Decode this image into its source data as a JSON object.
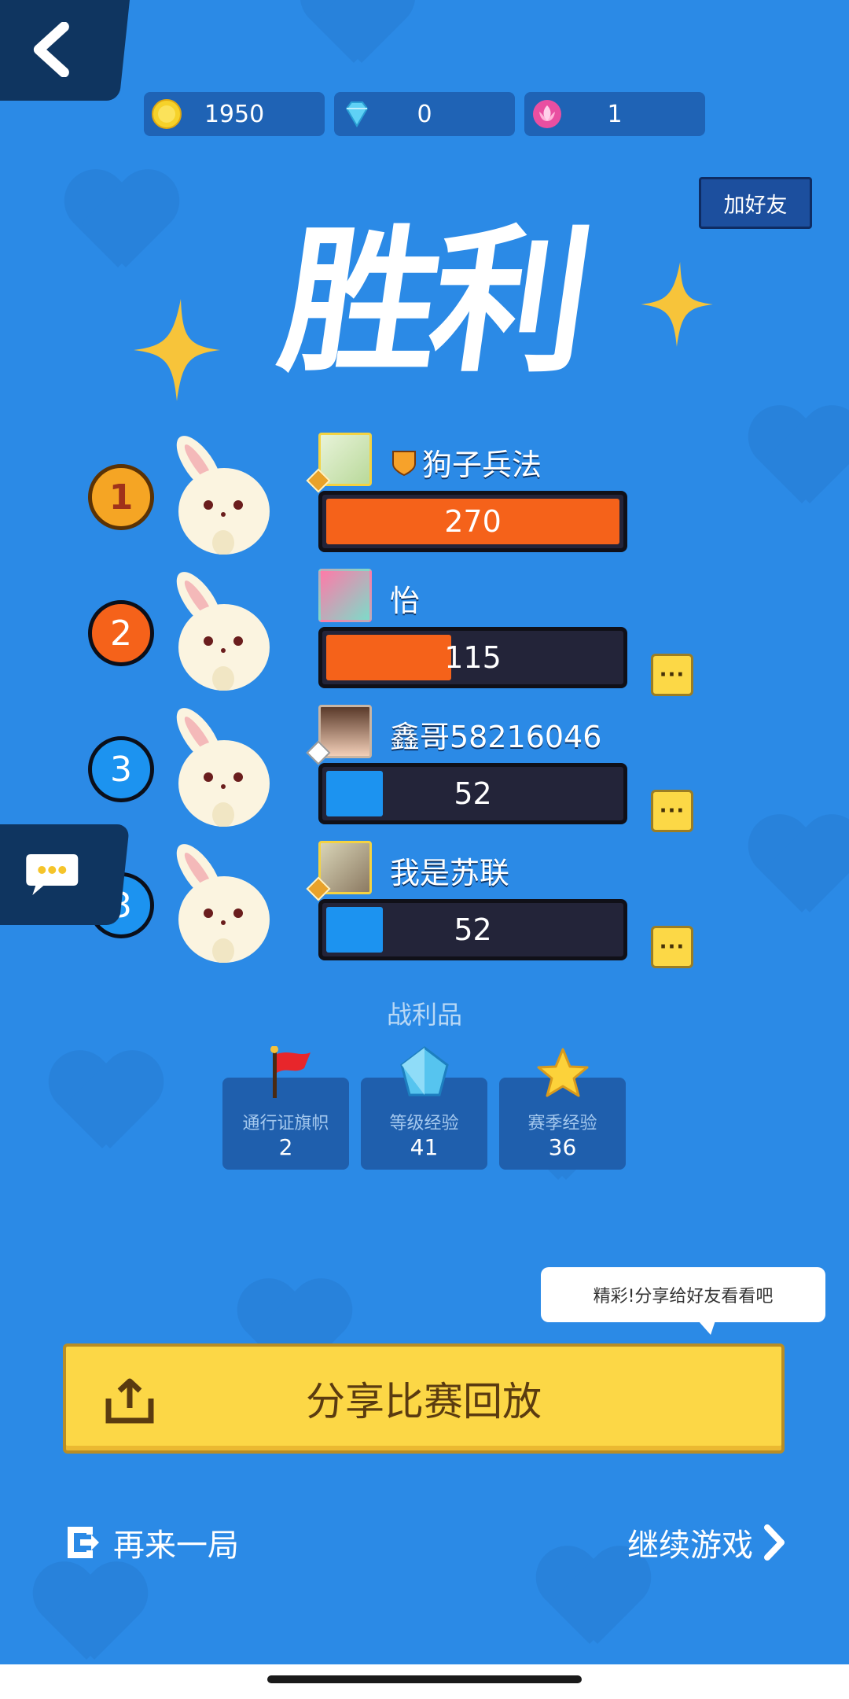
{
  "currencies": [
    {
      "name": "coin",
      "value": "1950",
      "icon": "coin-icon",
      "color": "#f6d22a"
    },
    {
      "name": "diamond",
      "value": "0",
      "icon": "diamond-icon",
      "color": "#5fd1f5"
    },
    {
      "name": "lotus",
      "value": "1",
      "icon": "lotus-icon",
      "color": "#e94fa1"
    }
  ],
  "header": {
    "add_friend_label": "加好友",
    "title": "胜利"
  },
  "players": [
    {
      "rank": "1",
      "name": "狗子兵法",
      "score": "270",
      "score_value": 270,
      "fill_color": "#f5621a",
      "has_more": false
    },
    {
      "rank": "2",
      "name": "怡",
      "score": "115",
      "score_value": 115,
      "fill_color": "#f5621a",
      "has_more": true
    },
    {
      "rank": "3",
      "name": "鑫哥58216046",
      "score": "52",
      "score_value": 52,
      "fill_color": "#1c93f0",
      "has_more": true
    },
    {
      "rank": "3",
      "name": "我是苏联",
      "score": "52",
      "score_value": 52,
      "fill_color": "#1c93f0",
      "has_more": true
    }
  ],
  "more_label": "···",
  "loot": {
    "title": "战利品",
    "items": [
      {
        "label": "通行证旗帜",
        "value": "2",
        "icon": "flag-icon"
      },
      {
        "label": "等级经验",
        "value": "41",
        "icon": "crystal-icon"
      },
      {
        "label": "赛季经验",
        "value": "36",
        "icon": "star-icon"
      }
    ]
  },
  "tooltip": "精彩!分享给好友看看吧",
  "share_label": "分享比赛回放",
  "again_label": "再来一局",
  "continue_label": "继续游戏"
}
